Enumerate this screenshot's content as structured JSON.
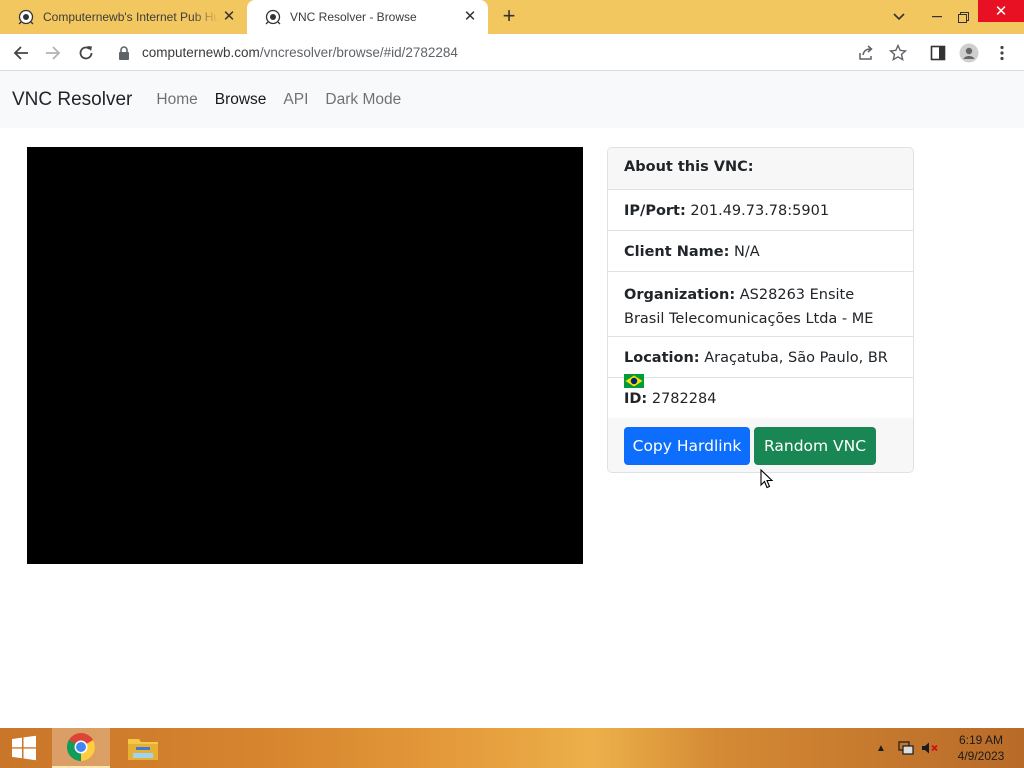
{
  "browser": {
    "tabs": [
      {
        "title": "Computernewb's Internet Pub Hub",
        "active": false
      },
      {
        "title": "VNC Resolver - Browse",
        "active": true
      }
    ],
    "url": {
      "host": "computernewb.com",
      "path": "/vncresolver/browse/#id/2782284"
    }
  },
  "navbar": {
    "brand": "VNC Resolver",
    "links": [
      {
        "label": "Home",
        "active": false
      },
      {
        "label": "Browse",
        "active": true
      },
      {
        "label": "API",
        "active": false
      },
      {
        "label": "Dark Mode",
        "active": false
      }
    ]
  },
  "card": {
    "header": "About this VNC:",
    "ip_label": "IP/Port:",
    "ip_value": "201.49.73.78:5901",
    "client_label": "Client Name:",
    "client_value": "N/A",
    "org_label": "Organization:",
    "org_value": "AS28263 Ensite Brasil Telecomunicações Ltda - ME",
    "location_label": "Location:",
    "location_value": "Araçatuba, São Paulo, BR",
    "id_label": "ID:",
    "id_value": "2782284",
    "copy_button": "Copy Hardlink",
    "random_button": "Random VNC"
  },
  "taskbar": {
    "time": "6:19 AM",
    "date": "4/9/2023"
  },
  "colors": {
    "tabbar": "#f3c75f",
    "primary": "#0d6efd",
    "success": "#198754",
    "close": "#e81123"
  }
}
